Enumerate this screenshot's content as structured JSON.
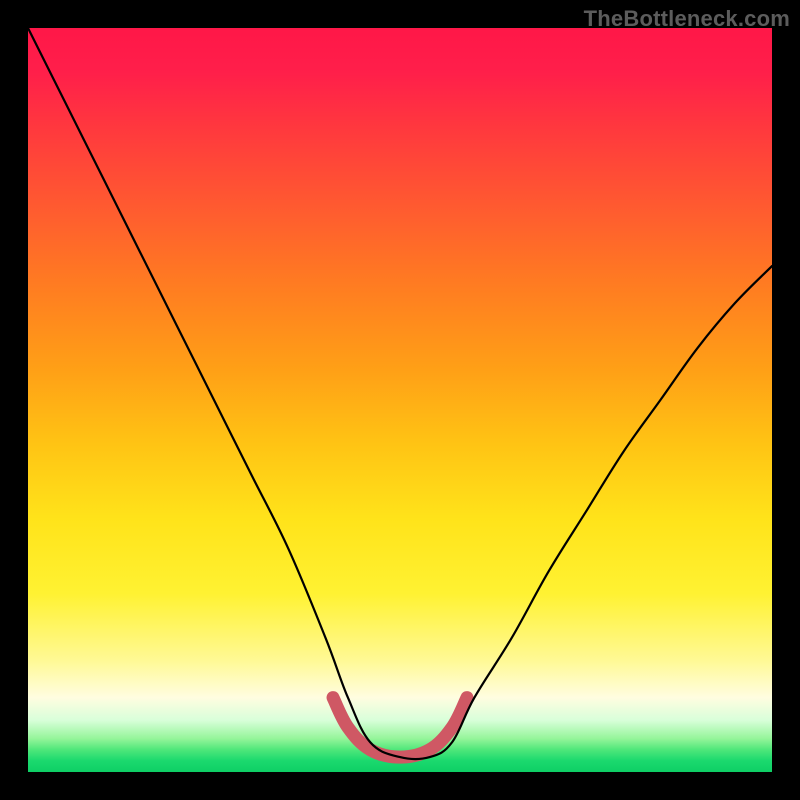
{
  "watermark": "TheBottleneck.com",
  "colors": {
    "frame": "#000000",
    "curve": "#000000",
    "highlight": "#cf5864",
    "gradient_top": "#ff1748",
    "gradient_bottom": "#0ecf65"
  },
  "chart_data": {
    "type": "line",
    "title": "",
    "xlabel": "",
    "ylabel": "",
    "xlim": [
      0,
      100
    ],
    "ylim": [
      0,
      100
    ],
    "grid": false,
    "legend": false,
    "series": [
      {
        "name": "bottleneck-curve",
        "x": [
          0,
          5,
          10,
          15,
          20,
          25,
          30,
          35,
          40,
          43,
          46,
          50,
          54,
          57,
          60,
          65,
          70,
          75,
          80,
          85,
          90,
          95,
          100
        ],
        "y": [
          100,
          90,
          80,
          70,
          60,
          50,
          40,
          30,
          18,
          10,
          4,
          2,
          2,
          4,
          10,
          18,
          27,
          35,
          43,
          50,
          57,
          63,
          68
        ]
      },
      {
        "name": "optimal-range-highlight",
        "x": [
          41,
          43,
          46,
          50,
          54,
          57,
          59
        ],
        "y": [
          10,
          6,
          3,
          2,
          3,
          6,
          10
        ]
      }
    ],
    "annotations": []
  }
}
